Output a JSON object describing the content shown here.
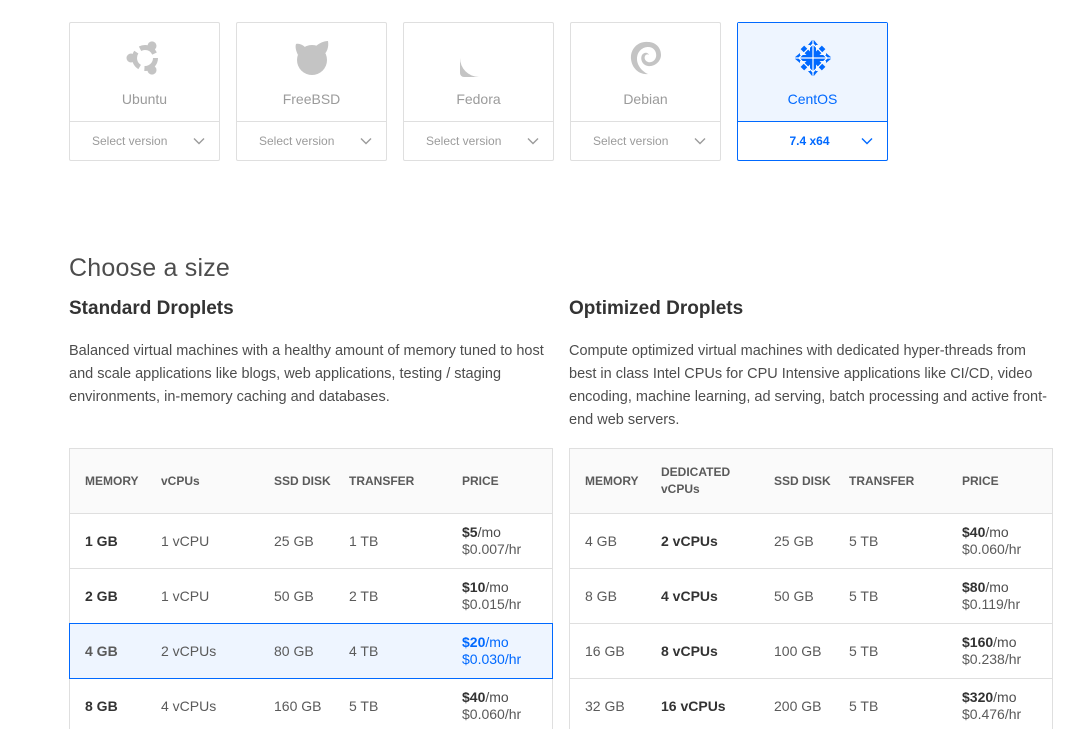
{
  "distros": [
    {
      "name": "Ubuntu",
      "icon": "ubuntu-icon",
      "version": "Select version",
      "selected": false
    },
    {
      "name": "FreeBSD",
      "icon": "freebsd-icon",
      "version": "Select version",
      "selected": false
    },
    {
      "name": "Fedora",
      "icon": "fedora-icon",
      "version": "Select version",
      "selected": false
    },
    {
      "name": "Debian",
      "icon": "debian-icon",
      "version": "Select version",
      "selected": false
    },
    {
      "name": "CentOS",
      "icon": "centos-icon",
      "version": "7.4 x64",
      "selected": true
    }
  ],
  "size": {
    "title": "Choose a size",
    "standard": {
      "title": "Standard Droplets",
      "description": "Balanced virtual machines with a healthy amount of memory tuned to host and scale applications like blogs, web applications, testing / staging environments, in-memory caching and databases.",
      "headers": [
        "MEMORY",
        "vCPUs",
        "SSD DISK",
        "TRANSFER",
        "PRICE"
      ],
      "rows": [
        {
          "memory": "1 GB",
          "vcpus": "1 vCPU",
          "disk": "25 GB",
          "transfer": "1 TB",
          "price_mo": "$5",
          "price_hr": "$0.007/hr",
          "selected": false
        },
        {
          "memory": "2 GB",
          "vcpus": "1 vCPU",
          "disk": "50 GB",
          "transfer": "2 TB",
          "price_mo": "$10",
          "price_hr": "$0.015/hr",
          "selected": false
        },
        {
          "memory": "4 GB",
          "vcpus": "2 vCPUs",
          "disk": "80 GB",
          "transfer": "4 TB",
          "price_mo": "$20",
          "price_hr": "$0.030/hr",
          "selected": true
        },
        {
          "memory": "8 GB",
          "vcpus": "4 vCPUs",
          "disk": "160 GB",
          "transfer": "5 TB",
          "price_mo": "$40",
          "price_hr": "$0.060/hr",
          "selected": false
        }
      ]
    },
    "optimized": {
      "title": "Optimized Droplets",
      "description": "Compute optimized virtual machines with dedicated hyper-threads from best in class Intel CPUs for CPU Intensive applications like CI/CD, video encoding, machine learning, ad serving, batch processing and active front-end web servers.",
      "headers": [
        "MEMORY",
        "DEDICATED vCPUs",
        "SSD DISK",
        "TRANSFER",
        "PRICE"
      ],
      "rows": [
        {
          "memory": "4 GB",
          "vcpus": "2 vCPUs",
          "disk": "25 GB",
          "transfer": "5 TB",
          "price_mo": "$40",
          "price_hr": "$0.060/hr",
          "selected": false
        },
        {
          "memory": "8 GB",
          "vcpus": "4 vCPUs",
          "disk": "50 GB",
          "transfer": "5 TB",
          "price_mo": "$80",
          "price_hr": "$0.119/hr",
          "selected": false
        },
        {
          "memory": "16 GB",
          "vcpus": "8 vCPUs",
          "disk": "100 GB",
          "transfer": "5 TB",
          "price_mo": "$160",
          "price_hr": "$0.238/hr",
          "selected": false
        },
        {
          "memory": "32 GB",
          "vcpus": "16 vCPUs",
          "disk": "200 GB",
          "transfer": "5 TB",
          "price_mo": "$320",
          "price_hr": "$0.476/hr",
          "selected": false
        }
      ]
    },
    "per_month": "/mo"
  },
  "colors": {
    "accent": "#0069ff",
    "muted": "#c4c4c4",
    "border": "#dfdfdf",
    "selected_bg": "#eef5ff"
  }
}
